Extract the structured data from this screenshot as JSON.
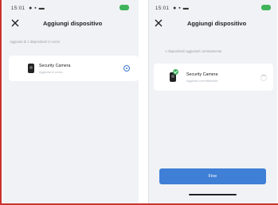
{
  "screens": [
    {
      "status_time": "15:01",
      "header": {
        "title": "Aggiungi dispositivo"
      },
      "hint": "Aggiunta di 1 dispositivo/i in corso",
      "device": {
        "name": "Security Camera",
        "status": "Aggiunta in corso..."
      }
    },
    {
      "status_time": "15:01",
      "header": {
        "title": "Aggiungi dispositivo"
      },
      "hint": "1 dispositivo/i aggiunto/i correttamente",
      "device": {
        "name": "Security Camera",
        "status": "Aggiunto correttamente"
      },
      "done_button": "Fine"
    }
  ],
  "colors": {
    "accent": "#3f7fd6",
    "success": "#3fb15c",
    "battery": "#40b45a",
    "frame": "#c8322d"
  }
}
